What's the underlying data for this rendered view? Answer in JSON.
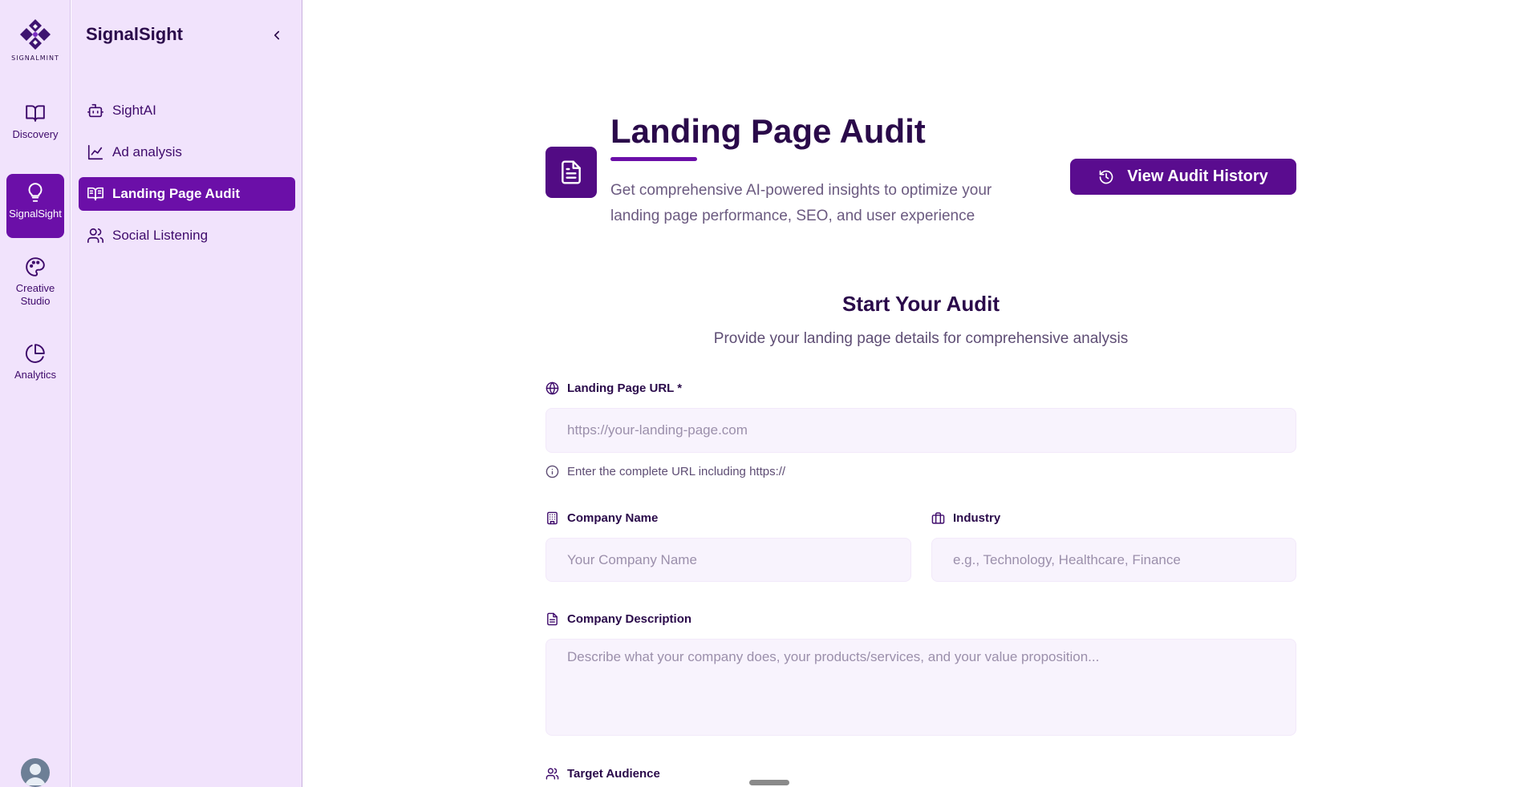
{
  "brand": {
    "logo_text": "SIGNALMINT"
  },
  "rail": {
    "items": [
      {
        "label": "Discovery",
        "icon": "book-open-icon"
      },
      {
        "label": "SignalSight",
        "icon": "lightbulb-icon",
        "active": true
      },
      {
        "label": "Creative Studio",
        "icon": "palette-icon"
      },
      {
        "label": "Analytics",
        "icon": "pie-chart-icon"
      }
    ]
  },
  "sidebar": {
    "title": "SignalSight",
    "items": [
      {
        "label": "SightAI",
        "icon": "bot-icon"
      },
      {
        "label": "Ad analysis",
        "icon": "line-chart-icon"
      },
      {
        "label": "Landing Page Audit",
        "icon": "book-open-text-icon",
        "active": true
      },
      {
        "label": "Social Listening",
        "icon": "users-icon"
      }
    ]
  },
  "header": {
    "title": "Landing Page Audit",
    "subtitle": "Get comprehensive AI-powered insights to optimize your landing page performance, SEO, and user experience",
    "history_button": "View Audit History"
  },
  "form": {
    "title": "Start Your Audit",
    "subtitle": "Provide your landing page details for comprehensive analysis",
    "url_label": "Landing Page URL *",
    "url_placeholder": "https://your-landing-page.com",
    "url_hint": "Enter the complete URL including https://",
    "company_label": "Company Name",
    "company_placeholder": "Your Company Name",
    "industry_label": "Industry",
    "industry_placeholder": "e.g., Technology, Healthcare, Finance",
    "description_label": "Company Description",
    "description_placeholder": "Describe what your company does, your products/services, and your value proposition...",
    "audience_label": "Target Audience"
  },
  "colors": {
    "accent": "#6b0fa8",
    "sidebar_bg": "#f1e3fc",
    "title": "#2a0a4a"
  }
}
